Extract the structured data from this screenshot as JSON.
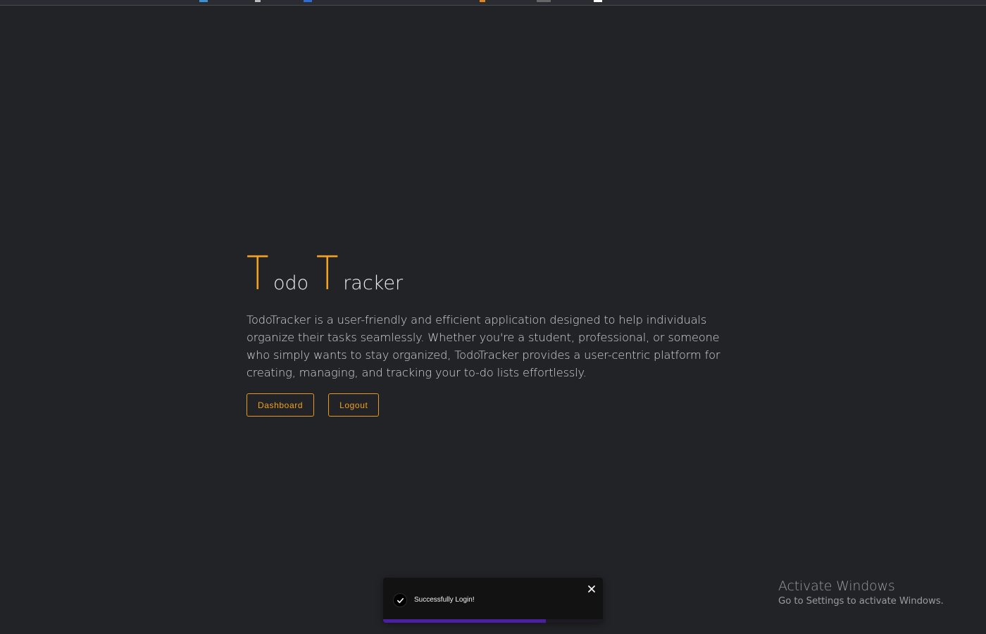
{
  "app": {
    "title_part1_initial": "T",
    "title_part1_rest": "odo",
    "title_part2_initial": "T",
    "title_part2_rest": "racker",
    "description": "TodoTracker is a user-friendly and efficient application designed to help individuals organize their tasks seamlessly. Whether you're a student, professional, or someone who simply wants to stay organized, TodoTracker provides a user-centric platform for creating, managing, and tracking your to-do lists effortlessly."
  },
  "actions": {
    "dashboard_label": "Dashboard",
    "logout_label": "Logout"
  },
  "toast": {
    "message": "Successfully Login!",
    "icon": "check-circle-icon",
    "close_icon": "close-icon",
    "progress": 0.74,
    "progress_color": "#4b1fa3"
  },
  "watermark": {
    "heading": "Activate Windows",
    "subtext": "Go to Settings to activate Windows."
  },
  "colors": {
    "background": "#222326",
    "accent": "#f5a31a",
    "text": "#e6e6e6"
  }
}
